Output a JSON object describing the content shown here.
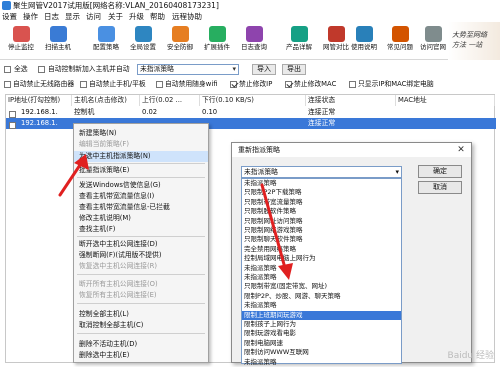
{
  "window": {
    "title": "聚生网管V2017试用版[网络名称:VLAN_20160408173231]"
  },
  "menu": [
    "设置",
    "操作",
    "日志",
    "显示",
    "访问",
    "关于",
    "升级",
    "帮助",
    "远程协助"
  ],
  "toolbar": [
    {
      "label": "停止监控",
      "icon": "stop-monitor-icon",
      "color": "#d9534f"
    },
    {
      "label": "扫描主机",
      "icon": "scan-host-icon",
      "color": "#3a7bd5"
    },
    {
      "label": "配置策略",
      "icon": "config-policy-icon",
      "color": "#4a90e2"
    },
    {
      "label": "全局设置",
      "icon": "global-settings-icon",
      "color": "#2e86c1"
    },
    {
      "label": "安全防御",
      "icon": "security-icon",
      "color": "#e67e22"
    },
    {
      "label": "扩展插件",
      "icon": "plugin-icon",
      "color": "#27ae60"
    },
    {
      "label": "日志查询",
      "icon": "log-query-icon",
      "color": "#8e44ad"
    },
    {
      "label": "产品详解",
      "icon": "product-icon",
      "color": "#16a085"
    },
    {
      "label": "网管对比",
      "icon": "compare-icon",
      "color": "#c0392b"
    },
    {
      "label": "使用说明",
      "icon": "manual-icon",
      "color": "#2980b9"
    },
    {
      "label": "常见问题",
      "icon": "faq-icon",
      "color": "#d35400"
    },
    {
      "label": "访问官网",
      "icon": "website-icon",
      "color": "#7f8c8d"
    }
  ],
  "banner": {
    "line1": "大势至网络",
    "line2": "方法 一站"
  },
  "filter": {
    "select_all": "全选",
    "auto_control": "自动控制新加入主机并自动",
    "policy_value": "未指派策略",
    "import_label": "导入",
    "export_label": "导出",
    "row2": [
      {
        "label": "自动禁止无线路由器",
        "checked": false
      },
      {
        "label": "自动禁止手机/平板",
        "checked": false
      },
      {
        "label": "自动禁用随身wifi",
        "checked": false
      },
      {
        "label": "禁止修改IP",
        "checked": true
      },
      {
        "label": "禁止修改MAC",
        "checked": true
      },
      {
        "label": "只显示IP和MAC绑定电脑",
        "checked": false
      }
    ]
  },
  "table": {
    "headers": [
      "IP地址(打勾控制)",
      "主机名(点击修改)",
      "上行(0.02 ...",
      "下行(0.10 KB/S)",
      "连接状态",
      "MAC地址"
    ],
    "rows": [
      {
        "ip": "192.168.1.",
        "host": "控制机",
        "up": "0.02",
        "down": "0.10",
        "status": "连接正常",
        "mac": ""
      },
      {
        "ip": "192.168.1.",
        "host": "",
        "up": "",
        "down": "",
        "status": "连接正常",
        "mac": ""
      }
    ]
  },
  "context_menu": [
    {
      "label": "新建策略(N)",
      "disabled": false
    },
    {
      "label": "编辑当前策略(F)",
      "disabled": true
    },
    {
      "label": "为选中主机指派策略(N)",
      "disabled": false,
      "highlight": true
    },
    {
      "sep": true
    },
    {
      "label": "批量指派策略(E)",
      "disabled": false
    },
    {
      "sep": true
    },
    {
      "label": "发送Windows信使信息(G)",
      "disabled": false
    },
    {
      "label": "查看主机带宽流量信息(I)",
      "disabled": false
    },
    {
      "label": "查看主机带宽流量信息-已拦截",
      "disabled": false
    },
    {
      "label": "修改主机说明(M)",
      "disabled": false
    },
    {
      "label": "查找主机(F)",
      "disabled": false
    },
    {
      "sep": true
    },
    {
      "label": "断开选中主机公网连接(D)",
      "disabled": false
    },
    {
      "label": "强制断网(F)(试用版不提供)",
      "disabled": false
    },
    {
      "label": "恢复选中主机公网连接(R)",
      "disabled": true
    },
    {
      "sep": true
    },
    {
      "label": "断开所有主机公网连接(O)",
      "disabled": true
    },
    {
      "label": "恢复所有主机公网连接(E)",
      "disabled": true
    },
    {
      "sep": true
    },
    {
      "label": "控制全部主机(L)",
      "disabled": false
    },
    {
      "label": "取消控制全部主机(C)",
      "disabled": false
    },
    {
      "sep": true
    },
    {
      "label": "删除不活动主机(D)",
      "disabled": false
    },
    {
      "label": "删除选中主机(E)",
      "disabled": false
    }
  ],
  "dialog": {
    "title": "重新指派策略",
    "combo_value": "未指派策略",
    "ok_label": "确定",
    "cancel_label": "取消",
    "options": [
      "未指派策略",
      "只限制P2P下载策略",
      "只限制带宽流量策略",
      "只限制股软件策略",
      "只限制网址访问策略",
      "只限制网络游戏策略",
      "只限制聊天软件策略",
      "完全禁用网络策略",
      "控制局域网电脑上网行为",
      "未指派策略",
      "未指派策略",
      "只限制带宽(固定带宽、网址)",
      "限制P2P、炒股、网游、聊天策略",
      "未指派策略",
      "限制上班期间玩游戏",
      "限制孩子上网行为",
      "限制玩游戏看电影",
      "限制电脑网速",
      "限制访问WWW互联网",
      "未指派策略"
    ],
    "selected_index": 14
  },
  "watermark": "Baidu 经验"
}
